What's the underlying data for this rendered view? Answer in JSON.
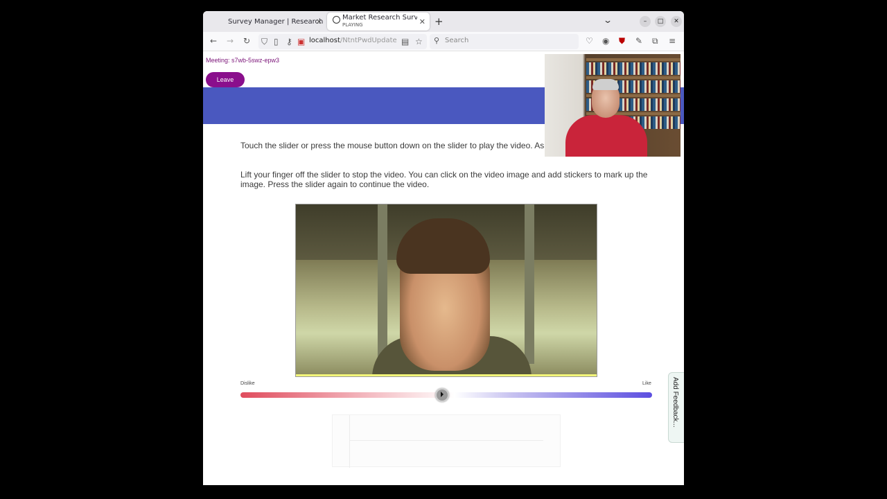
{
  "browser": {
    "tabs": [
      {
        "title": "Survey Manager | Research",
        "subtitle": "",
        "active": false
      },
      {
        "title": "Market Research Survey",
        "subtitle": "PLAYING",
        "active": true
      }
    ],
    "url": {
      "host": "localhost",
      "path": "/NtntPwdUpdate"
    },
    "search_placeholder": "Search"
  },
  "page": {
    "meeting_label": "Meeting: s7wb-5swz-epw3",
    "leave_label": "Leave",
    "banner_color": "#4a58bf",
    "instruction_1": "Touch the slider or press the mouse button down on the slider to play the video. As the video plays, move the slider to the left or the right to show how much you like or dislike what you are seeing.",
    "instruction_2": "Lift your finger off the slider to stop the video. You can click on the video image and add stickers to mark up the image. Press the slider again to continue the video.",
    "slider": {
      "left_label": "Dislike",
      "right_label": "Like",
      "value": 0.49,
      "left_color": "#e04c5d",
      "right_color": "#5c4ee0"
    },
    "feedback_tab": "Add Feedback..."
  }
}
